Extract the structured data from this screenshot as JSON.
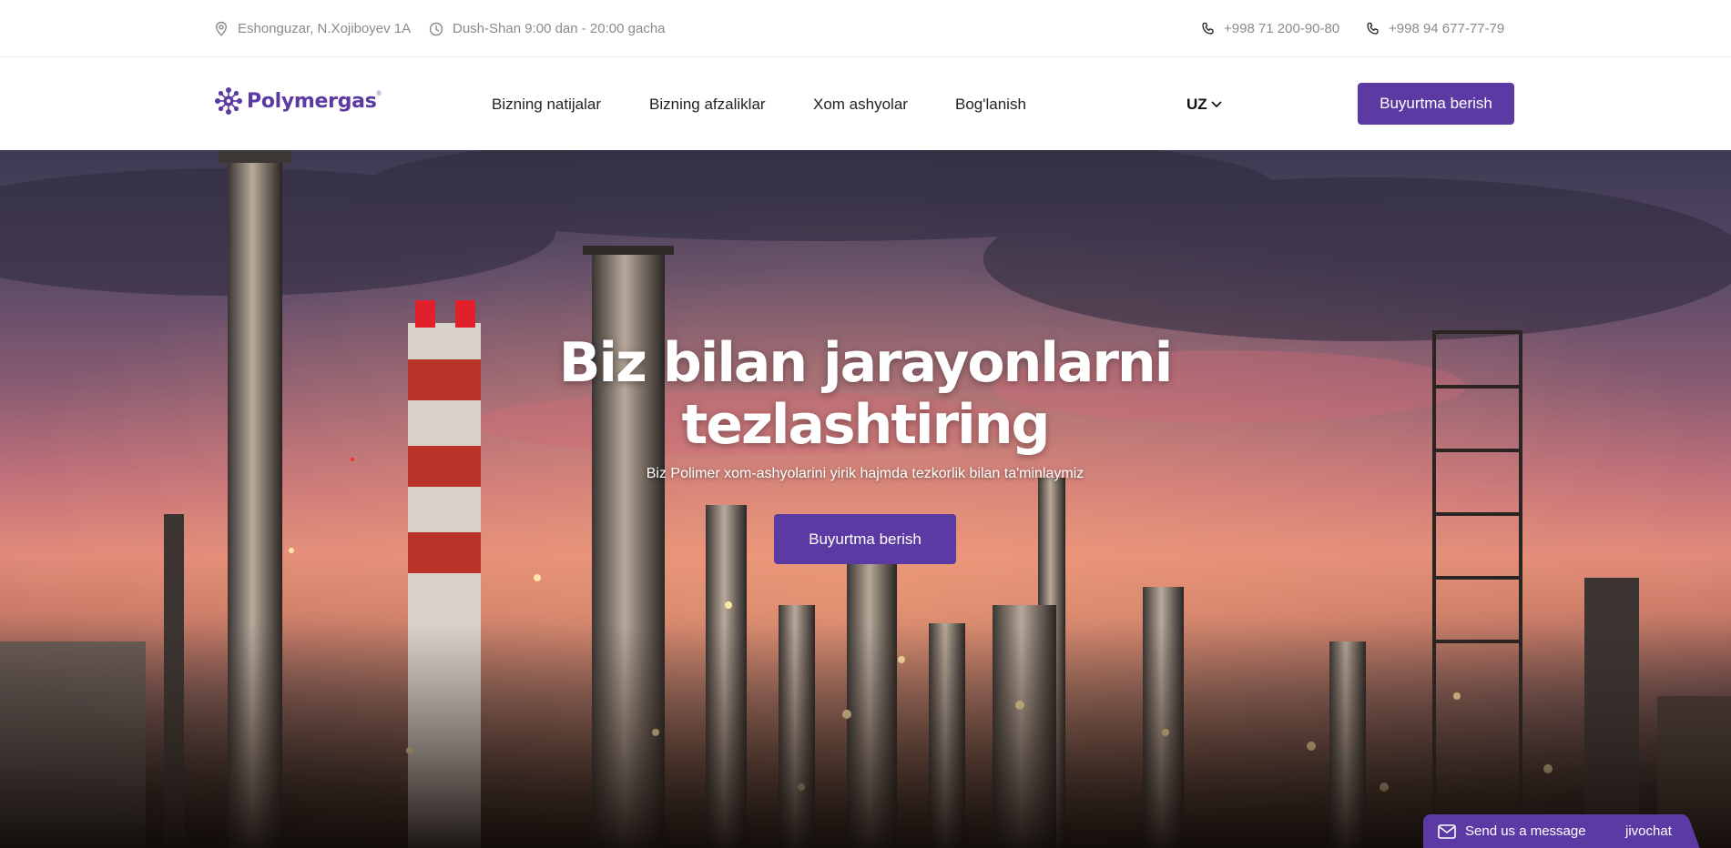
{
  "topbar": {
    "address": "Eshonguzar, N.Xojiboyev 1A",
    "hours": "Dush-Shan 9:00 dan - 20:00 gacha",
    "phone1": "+998 71 200-90-80",
    "phone2": "+998 94 677-77-79"
  },
  "brand": {
    "name": "Polymergas",
    "registered_mark": "®",
    "color": "#5b3aa3"
  },
  "nav": {
    "links": [
      "Bizning natijalar",
      "Bizning afzaliklar",
      "Xom ashyolar",
      "Bog'lanish"
    ],
    "language": "UZ",
    "order_button": "Buyurtma berish"
  },
  "hero": {
    "title_line1": "Biz bilan jarayonlarni",
    "title_line2": "tezlashtiring",
    "subtitle": "Biz Polimer xom-ashyolarini yirik hajmda tezkorlik bilan ta'minlaymiz",
    "cta_button": "Buyurtma berish"
  },
  "chat_widget": {
    "label": "Send us a message",
    "brand": "jivochat"
  },
  "icons": {
    "address": "map-pin-icon",
    "hours": "clock-icon",
    "phone": "phone-icon",
    "language_dropdown": "chevron-down-icon",
    "chat": "envelope-icon"
  }
}
